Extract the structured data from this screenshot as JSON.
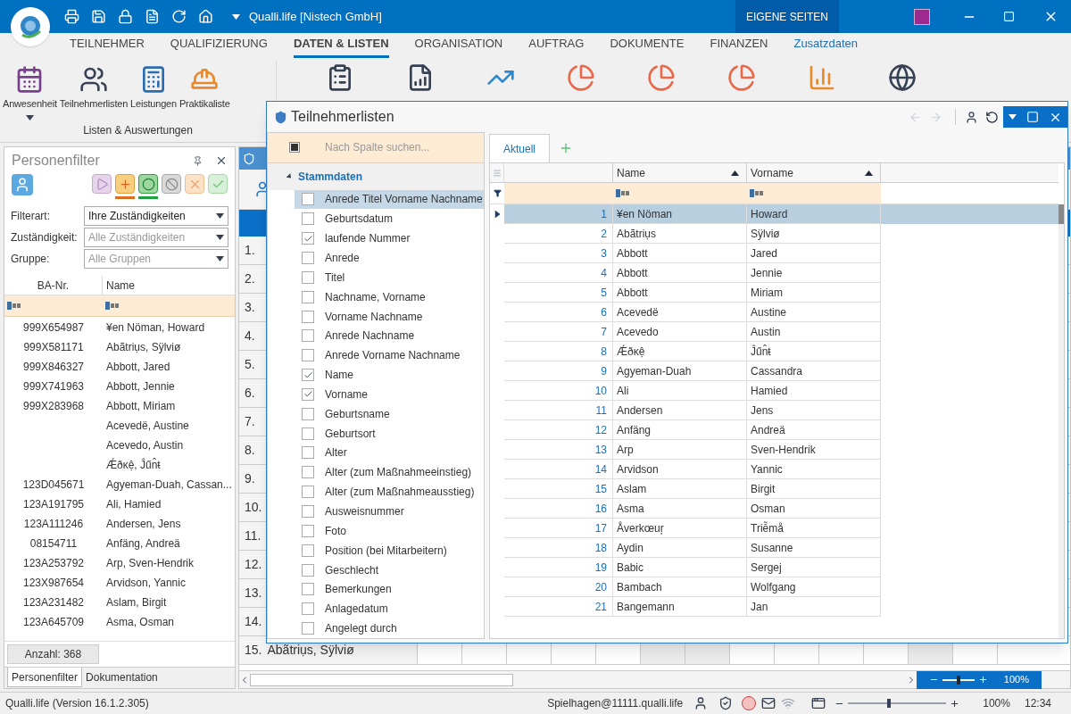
{
  "window": {
    "title": "Qualli.life [Nistech GmbH]",
    "extra_tab": "EIGENE SEITEN"
  },
  "ribbon_tabs": [
    {
      "label": "TEILNEHMER",
      "selected": false,
      "kind": "main"
    },
    {
      "label": "QUALIFIZIERUNG",
      "selected": false,
      "kind": "main"
    },
    {
      "label": "DATEN & LISTEN",
      "selected": true,
      "kind": "main"
    },
    {
      "label": "ORGANISATION",
      "selected": false,
      "kind": "main"
    },
    {
      "label": "AUFTRAG",
      "selected": false,
      "kind": "main"
    },
    {
      "label": "DOKUMENTE",
      "selected": false,
      "kind": "main"
    },
    {
      "label": "FINANZEN",
      "selected": false,
      "kind": "main"
    },
    {
      "label": "Zusatzdaten",
      "selected": false,
      "kind": "extra"
    }
  ],
  "ribbon_group": {
    "label": "Listen & Auswertungen",
    "buttons": [
      {
        "label": "Anwesenheit",
        "kind": "calendar",
        "dropdown": true
      },
      {
        "label": "Teilnehmerlisten",
        "kind": "people",
        "dropdown": false
      },
      {
        "label": "Leistungen",
        "kind": "calculator",
        "dropdown": false
      },
      {
        "label": "Praktikaliste",
        "kind": "worker",
        "dropdown": false
      }
    ]
  },
  "person_filter": {
    "title": "Personenfilter",
    "tools": [
      {
        "kind": "play",
        "active": false
      },
      {
        "kind": "add",
        "active": true
      },
      {
        "kind": "circle",
        "active": true
      },
      {
        "kind": "block",
        "active": false
      },
      {
        "kind": "cancel",
        "active": false
      },
      {
        "kind": "ok",
        "active": false
      }
    ],
    "fields": [
      {
        "label": "Filterart:",
        "value": "Ihre Zuständigkeiten"
      },
      {
        "label": "Zuständigkeit:",
        "placeholder": "Alle Zuständigkeiten"
      },
      {
        "label": "Gruppe:",
        "placeholder": "Alle Gruppen"
      }
    ],
    "columns": [
      "BA-Nr.",
      "Name"
    ],
    "rows": [
      {
        "ba": "999X654987",
        "name": "¥en Nöman, Howard"
      },
      {
        "ba": "999X581171",
        "name": "Abãtriụs, Sÿlviø"
      },
      {
        "ba": "999X846327",
        "name": "Abbott, Jared"
      },
      {
        "ba": "999X741963",
        "name": "Abbott, Jennie"
      },
      {
        "ba": "999X283968",
        "name": "Abbott, Miriam"
      },
      {
        "name": "Acevedë, Austine"
      },
      {
        "name": "Acevedo, Austin"
      },
      {
        "name": "Ǽðκệ, Ĵűn̂ŧ"
      },
      {
        "ba": "123D045671",
        "name": "Agyeman-Duah, Cassan..."
      },
      {
        "ba": "123A191795",
        "name": "Ali, Hamied"
      },
      {
        "ba": "123A111246",
        "name": "Andersen, Jens"
      },
      {
        "ba": "08154711",
        "name": "Anfäng, Andreä"
      },
      {
        "ba": "123A253792",
        "name": "Arp, Sven-Hendrik"
      },
      {
        "ba": "123X987654",
        "name": "Arvidson, Yannic"
      },
      {
        "ba": "123A231482",
        "name": "Aslam, Birgit"
      },
      {
        "ba": "123A645709",
        "name": "Asma, Osman"
      }
    ],
    "count": "Anzahl: 368",
    "tabs": [
      {
        "label": "Personenfilter",
        "selected": true
      },
      {
        "label": "Dokumentation",
        "selected": false
      }
    ]
  },
  "background_table": {
    "rows": [
      {
        "number": "1."
      },
      {
        "number": "2."
      },
      {
        "number": "3."
      },
      {
        "number": "4."
      },
      {
        "number": "5."
      },
      {
        "number": "6."
      },
      {
        "number": "7."
      },
      {
        "number": "8."
      },
      {
        "number": "9."
      },
      {
        "number": "10."
      },
      {
        "number": "11."
      },
      {
        "number": "12."
      },
      {
        "number": "13."
      },
      {
        "number": "14."
      },
      {
        "number": "15.",
        "name": "Abãtriụs, Sÿlviø"
      }
    ],
    "zoom": {
      "level": 0.5,
      "reading": "100%"
    }
  },
  "dialog": {
    "title": "Teilnehmerlisten",
    "search_placeholder": "Nach Spalte suchen...",
    "select_all_indeterminate": true,
    "group": {
      "label": "Stammdaten",
      "expanded": true,
      "items": [
        {
          "label": "Anrede Titel Vorname Nachname",
          "checked": false,
          "selected": true
        },
        {
          "label": "Geburtsdatum",
          "checked": false,
          "selected": false
        },
        {
          "label": "laufende Nummer",
          "checked": true,
          "selected": false
        },
        {
          "label": "Anrede",
          "checked": false,
          "selected": false
        },
        {
          "label": "Titel",
          "checked": false,
          "selected": false
        },
        {
          "label": "Nachname, Vorname",
          "checked": false,
          "selected": false
        },
        {
          "label": "Vorname Nachname",
          "checked": false,
          "selected": false
        },
        {
          "label": "Anrede Nachname",
          "checked": false,
          "selected": false
        },
        {
          "label": "Anrede Vorname Nachname",
          "checked": false,
          "selected": false
        },
        {
          "label": "Name",
          "checked": true,
          "selected": false
        },
        {
          "label": "Vorname",
          "checked": true,
          "selected": false
        },
        {
          "label": "Geburtsname",
          "checked": false,
          "selected": false
        },
        {
          "label": "Geburtsort",
          "checked": false,
          "selected": false
        },
        {
          "label": "Alter",
          "checked": false,
          "selected": false
        },
        {
          "label": "Alter (zum Maßnahmeeinstieg)",
          "checked": false,
          "selected": false
        },
        {
          "label": "Alter (zum Maßnahmeausstieg)",
          "checked": false,
          "selected": false
        },
        {
          "label": "Ausweisnummer",
          "checked": false,
          "selected": false
        },
        {
          "label": "Foto",
          "checked": false,
          "selected": false
        },
        {
          "label": "Position (bei Mitarbeitern)",
          "checked": false,
          "selected": false
        },
        {
          "label": "Geschlecht",
          "checked": false,
          "selected": false
        },
        {
          "label": "Bemerkungen",
          "checked": false,
          "selected": false
        },
        {
          "label": "Anlagedatum",
          "checked": false,
          "selected": false
        },
        {
          "label": "Angelegt durch",
          "checked": false,
          "selected": false
        }
      ]
    },
    "tabs": [
      {
        "label": "Aktuell",
        "selected": true
      }
    ],
    "grid": {
      "columns": [
        "Name",
        "Vorname"
      ],
      "rows": [
        {
          "num": "1",
          "name": "¥en Nöman",
          "vorname": "Howard",
          "selected": true
        },
        {
          "num": "2",
          "name": "Abãtriụs",
          "vorname": "Sÿlviø",
          "selected": false
        },
        {
          "num": "3",
          "name": "Abbott",
          "vorname": "Jared",
          "selected": false
        },
        {
          "num": "4",
          "name": "Abbott",
          "vorname": "Jennie",
          "selected": false
        },
        {
          "num": "5",
          "name": "Abbott",
          "vorname": "Miriam",
          "selected": false
        },
        {
          "num": "6",
          "name": "Acevedë",
          "vorname": "Austine",
          "selected": false
        },
        {
          "num": "7",
          "name": "Acevedo",
          "vorname": "Austin",
          "selected": false
        },
        {
          "num": "8",
          "name": "Ǽðκệ",
          "vorname": "Ĵűn̂ŧ",
          "selected": false
        },
        {
          "num": "9",
          "name": "Agyeman-Duah",
          "vorname": "Cassandra",
          "selected": false
        },
        {
          "num": "10",
          "name": "Ali",
          "vorname": "Hamied",
          "selected": false
        },
        {
          "num": "11",
          "name": "Andersen",
          "vorname": "Jens",
          "selected": false
        },
        {
          "num": "12",
          "name": "Anfäng",
          "vorname": "Andreä",
          "selected": false
        },
        {
          "num": "13",
          "name": "Arp",
          "vorname": "Sven-Hendrik",
          "selected": false
        },
        {
          "num": "14",
          "name": "Arvidson",
          "vorname": "Yannic",
          "selected": false
        },
        {
          "num": "15",
          "name": "Aslam",
          "vorname": "Birgit",
          "selected": false
        },
        {
          "num": "16",
          "name": "Asma",
          "vorname": "Osman",
          "selected": false
        },
        {
          "num": "17",
          "name": "Åverkœuŗ",
          "vorname": "Triễmå",
          "selected": false
        },
        {
          "num": "18",
          "name": "Aydin",
          "vorname": "Susanne",
          "selected": false
        },
        {
          "num": "19",
          "name": "Babic",
          "vorname": "Sergej",
          "selected": false
        },
        {
          "num": "20",
          "name": "Bambach",
          "vorname": "Wolfgang",
          "selected": false
        },
        {
          "num": "21",
          "name": "Bangemann",
          "vorname": "Jan",
          "selected": false
        }
      ]
    }
  },
  "status_bar": {
    "version": "Qualli.life (Version 16.1.2.305)",
    "user": "Spielhagen@11111.qualli.life",
    "zoom": {
      "level": 0.42,
      "reading": "100%"
    },
    "time": "12:34"
  }
}
